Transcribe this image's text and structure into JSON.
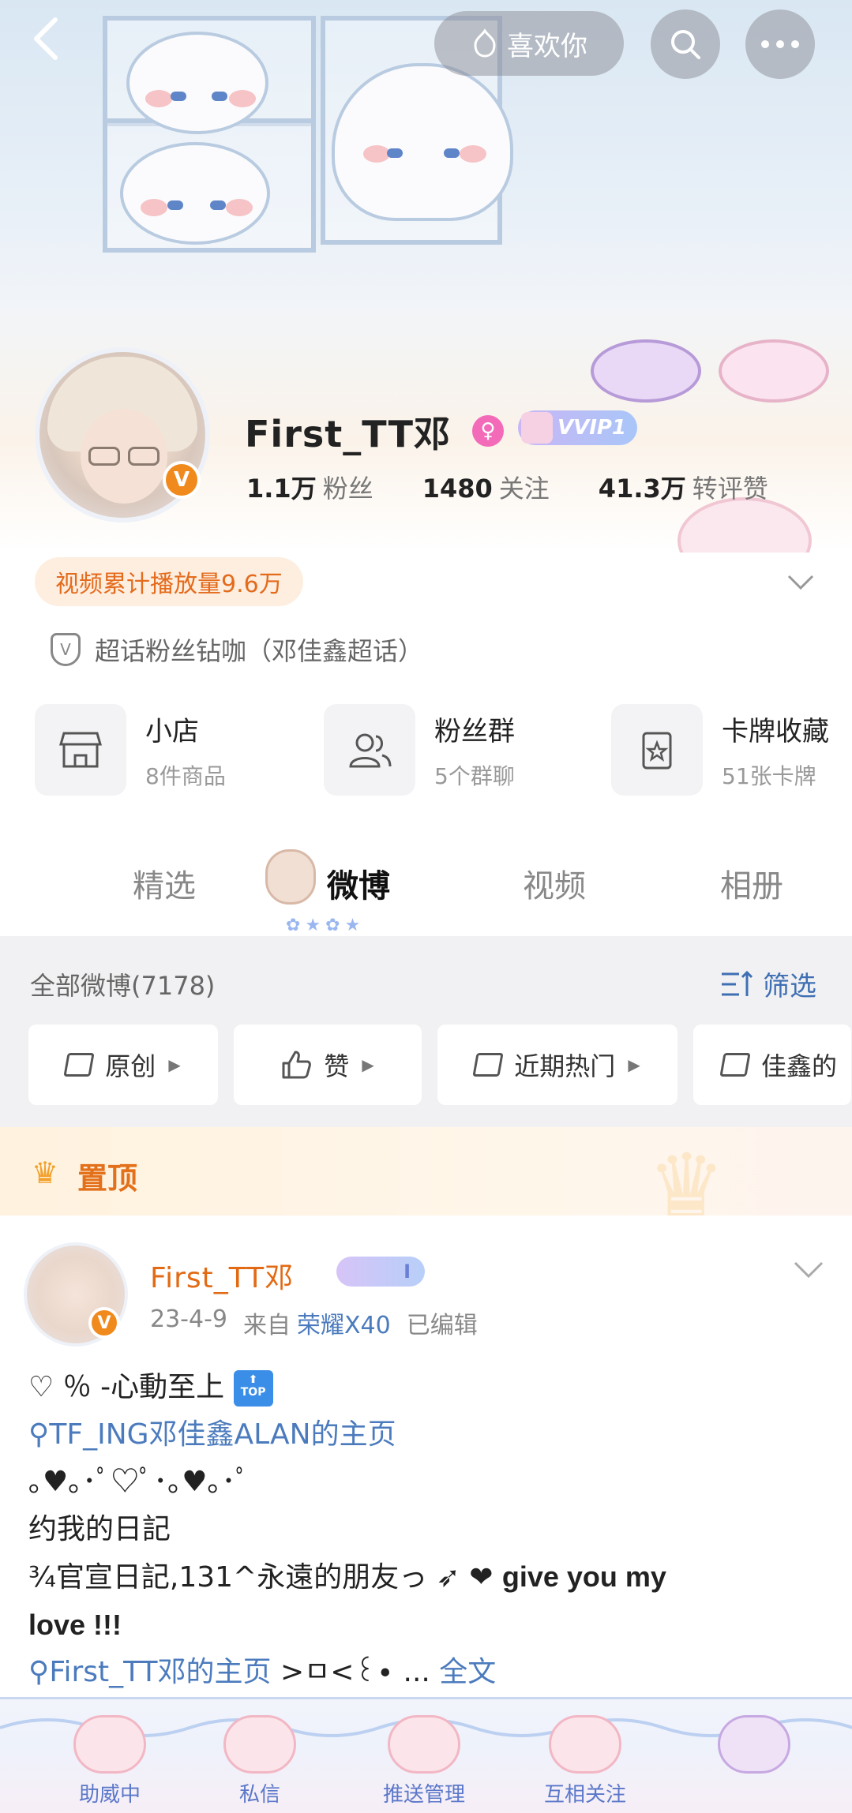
{
  "header": {
    "back_icon": "back-chevron-icon",
    "like_label": "喜欢你",
    "search_icon": "search-icon",
    "more_icon": "more-dots-icon"
  },
  "profile": {
    "username": "First_TT邓",
    "gender_icon": "female-icon",
    "vip_label": "VVIP1",
    "verified_badge": "V",
    "stats": [
      {
        "value": "1.1万",
        "label": "粉丝"
      },
      {
        "value": "1480",
        "label": "关注"
      },
      {
        "value": "41.3万",
        "label": "转评赞"
      }
    ],
    "play_count": "视频累计播放量9.6万",
    "super_topic": "超话粉丝钻咖（邓佳鑫超话）"
  },
  "services": [
    {
      "title": "小店",
      "sub": "8件商品",
      "icon": "shop-icon"
    },
    {
      "title": "粉丝群",
      "sub": "5个群聊",
      "icon": "group-icon"
    },
    {
      "title": "卡牌收藏",
      "sub": "51张卡牌",
      "icon": "card-icon"
    }
  ],
  "tabs": [
    {
      "label": "精选",
      "active": false
    },
    {
      "label": "微博",
      "active": true
    },
    {
      "label": "视频",
      "active": false
    },
    {
      "label": "相册",
      "active": false
    }
  ],
  "feed": {
    "title": "全部微博(7178)",
    "filter_label": "筛选",
    "chips": [
      "原创",
      "赞",
      "近期热门",
      "佳鑫的"
    ]
  },
  "pinned": {
    "label": "置顶"
  },
  "post": {
    "author": "First_TT邓",
    "vip_level": "I",
    "date": "23-4-9",
    "source_prefix": "来自",
    "device": "荣耀X40",
    "edited": "已编辑",
    "line1": "♡ ％ -心動至上",
    "top_icon_text": "TOP",
    "line2_link": "TF_ING邓佳鑫ALAN的主页",
    "line3": "｡♥｡･ﾟ♡ﾟ･｡♥｡･ﾟ",
    "line4": "约我的日記",
    "line5": "¾官宣日記,131^永遠的朋友っ ➶ ❤ ",
    "line5_bold": "give you my",
    "line6_bold": "love !!!",
    "line7_link": "First_TT邓的主页",
    "line7_tail": " >ㅁ<꒰∙ ...",
    "fulltext": "全文"
  },
  "bottom_bar": {
    "items": [
      "助威中",
      "私信",
      "推送管理",
      "互相关注"
    ]
  },
  "colors": {
    "accent_orange": "#e46b1c",
    "link_blue": "#4b7bbd",
    "vip_purple": "#c9b6f5"
  }
}
